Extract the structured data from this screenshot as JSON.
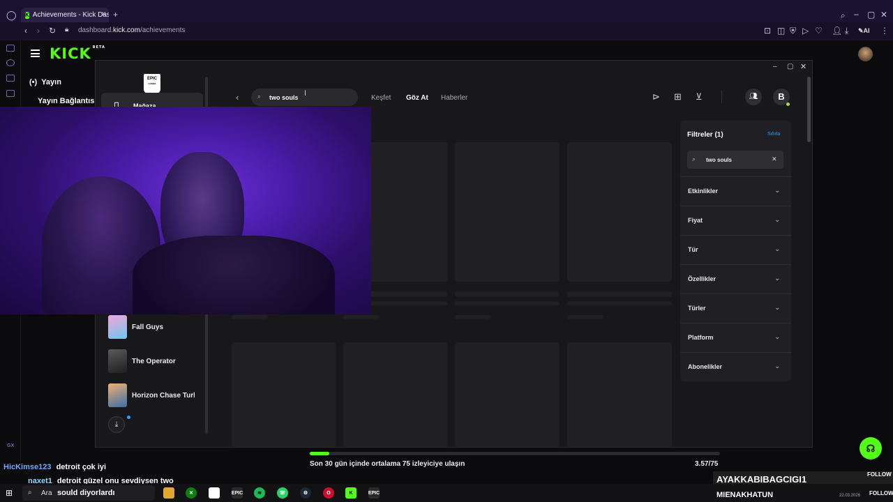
{
  "browser": {
    "tab_title": "Achievements - Kick Dashb",
    "url_prefix": "dashboard.",
    "url_domain": "kick.com",
    "url_path": "/achievements",
    "ai_label": "AI"
  },
  "kick": {
    "logo": "KICK",
    "beta": "BETA",
    "nav_stream": "Yayın",
    "nav_connection": "Yayın Bağlantısı"
  },
  "epic": {
    "logo_line1": "EPIC",
    "logo_line2": "GAMES",
    "store_label": "Mağaza",
    "search_value": "two souls",
    "nav": {
      "discover": "Keşfet",
      "browse": "Göz At",
      "news": "Haberler"
    },
    "avatar_letter": "B",
    "library": [
      {
        "name": "Fall Guys",
        "color": "#e66fb3"
      },
      {
        "name": "The Operator",
        "color": "#3a3a3a"
      },
      {
        "name": "Horizon Chase Turb",
        "color": "#c07a3a"
      }
    ],
    "filters": {
      "title": "Filtreler (1)",
      "reset": "Sıfırla",
      "search_value": "two souls",
      "items": [
        "Etkinlikler",
        "Fiyat",
        "Tür",
        "Özellikler",
        "Türler",
        "Platform",
        "Abonelikler"
      ]
    }
  },
  "goal": {
    "text": "Son 30 gün içinde ortalama 75 izleyiciye ulaşın",
    "value": "3.57/75",
    "progress": 0.048
  },
  "chat": [
    {
      "user": "HicKimse123",
      "message": "detroit çok iyi",
      "user_color": "#6fa8ff"
    },
    {
      "user": "naxet1",
      "message": "detroit güzel onu sevdiysen two",
      "user_color": "#8fd6ff"
    },
    {
      "user": "",
      "message": "sould diyorlardı",
      "user_color": "#ffffff"
    }
  ],
  "overlay": {
    "follow1": "FOLLOW",
    "name1": "AYAKKABIBAGCIGI1",
    "name2": "MIENAKHATUN",
    "follow2": "FOLLOW",
    "date": "22.03.2026"
  },
  "taskbar": {
    "search_label": "Ara",
    "apps": [
      "files-icon",
      "xbox-icon",
      "notepad-icon",
      "epic-icon",
      "spotify-icon",
      "whatsapp-icon",
      "steam-icon",
      "opera-icon",
      "kick-icon",
      "epic-games-icon"
    ]
  },
  "colors": {
    "kick_green": "#53fc18",
    "epic_bg": "#18181b",
    "filter_bg": "#202024"
  }
}
